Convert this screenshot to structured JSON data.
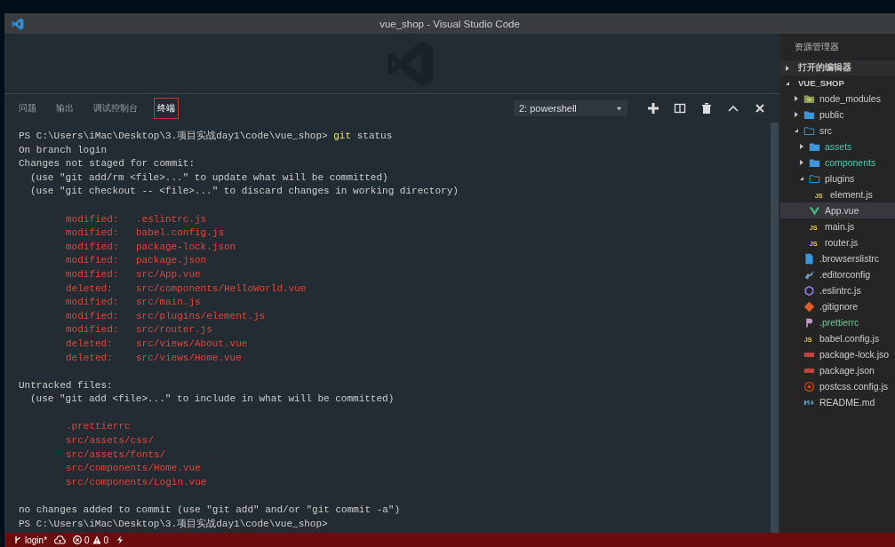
{
  "window": {
    "title": "vue_shop - Visual Studio Code"
  },
  "panel": {
    "tabs": [
      {
        "label": "问题",
        "selected": false
      },
      {
        "label": "输出",
        "selected": false
      },
      {
        "label": "调试控制台",
        "selected": false
      },
      {
        "label": "终端",
        "selected": true
      }
    ],
    "terminal_select": {
      "value": "2: powershell"
    }
  },
  "terminal": {
    "lines": [
      {
        "kind": "prompt",
        "text": "PS C:\\Users\\iMac\\Desktop\\3.项目实战day1\\code\\vue_shop>",
        "command": "git",
        "args": "status"
      },
      {
        "kind": "text",
        "text": "On branch login"
      },
      {
        "kind": "text",
        "text": "Changes not staged for commit:"
      },
      {
        "kind": "hint",
        "text": "(use \"git add/rm <file>...\" to update what will be committed)"
      },
      {
        "kind": "hint",
        "text": "(use \"git checkout -- <file>...\" to discard changes in working directory)"
      },
      {
        "kind": "blank"
      },
      {
        "kind": "change",
        "status": "modified:",
        "file": ".eslintrc.js"
      },
      {
        "kind": "change",
        "status": "modified:",
        "file": "babel.config.js"
      },
      {
        "kind": "change",
        "status": "modified:",
        "file": "package-lock.json"
      },
      {
        "kind": "change",
        "status": "modified:",
        "file": "package.json"
      },
      {
        "kind": "change",
        "status": "modified:",
        "file": "src/App.vue"
      },
      {
        "kind": "change",
        "status": "deleted:",
        "file": "src/components/HelloWorld.vue"
      },
      {
        "kind": "change",
        "status": "modified:",
        "file": "src/main.js"
      },
      {
        "kind": "change",
        "status": "modified:",
        "file": "src/plugins/element.js"
      },
      {
        "kind": "change",
        "status": "modified:",
        "file": "src/router.js"
      },
      {
        "kind": "change",
        "status": "deleted:",
        "file": "src/views/About.vue"
      },
      {
        "kind": "change",
        "status": "deleted:",
        "file": "src/views/Home.vue"
      },
      {
        "kind": "blank"
      },
      {
        "kind": "text",
        "text": "Untracked files:"
      },
      {
        "kind": "hint",
        "text": "(use \"git add <file>...\" to include in what will be committed)"
      },
      {
        "kind": "blank"
      },
      {
        "kind": "untracked",
        "text": ".prettierrc"
      },
      {
        "kind": "untracked",
        "text": "src/assets/css/"
      },
      {
        "kind": "untracked",
        "text": "src/assets/fonts/"
      },
      {
        "kind": "untracked",
        "text": "src/components/Home.vue"
      },
      {
        "kind": "untracked",
        "text": "src/components/Login.vue"
      },
      {
        "kind": "blank"
      },
      {
        "kind": "text",
        "text": "no changes added to commit (use \"git add\" and/or \"git commit -a\")"
      },
      {
        "kind": "text",
        "text": "PS C:\\Users\\iMac\\Desktop\\3.项目实战day1\\code\\vue_shop>"
      }
    ]
  },
  "sidebar": {
    "title": "资源管理器",
    "sections": [
      {
        "label": "打开的编辑器",
        "expanded": false
      },
      {
        "label": "VUE_SHOP",
        "expanded": true,
        "children": [
          {
            "name": "node_modules",
            "kind": "modules-folder",
            "expanded": false
          },
          {
            "name": "public",
            "kind": "folder",
            "expanded": false
          },
          {
            "name": "src",
            "kind": "folder",
            "expanded": true,
            "children": [
              {
                "name": "assets",
                "kind": "folder",
                "expanded": false,
                "color": "#4ec9b0"
              },
              {
                "name": "components",
                "kind": "folder",
                "expanded": false,
                "color": "#4ec9b0"
              },
              {
                "name": "plugins",
                "kind": "folder",
                "expanded": true,
                "children": [
                  {
                    "name": "element.js",
                    "kind": "js",
                    "icon_text": "JS",
                    "selected": false
                  }
                ]
              },
              {
                "name": "App.vue",
                "kind": "vue",
                "selected": true
              },
              {
                "name": "main.js",
                "kind": "js",
                "icon_text": "JS",
                "selected": false
              },
              {
                "name": "router.js",
                "kind": "js",
                "icon_text": "JS",
                "selected": false
              }
            ]
          },
          {
            "name": ".browserslistrc",
            "kind": "file",
            "selected": false
          },
          {
            "name": ".editorconfig",
            "kind": "editorconfig",
            "selected": false
          },
          {
            "name": ".eslintrc.js",
            "kind": "eslint",
            "selected": false
          },
          {
            "name": ".gitignore",
            "kind": "git",
            "selected": false
          },
          {
            "name": ".prettierrc",
            "kind": "prettier",
            "selected": false,
            "color": "#73c991"
          },
          {
            "name": "babel.config.js",
            "kind": "js",
            "icon_text": "JS",
            "selected": false
          },
          {
            "name": "package-lock.jso",
            "kind": "json",
            "selected": false
          },
          {
            "name": "package.json",
            "kind": "json",
            "selected": false
          },
          {
            "name": "postcss.config.js",
            "kind": "postcss",
            "selected": false
          },
          {
            "name": "README.md",
            "kind": "md",
            "selected": false
          }
        ]
      }
    ]
  },
  "status_bar": {
    "branch": "login*",
    "errors": "0",
    "warnings": "0"
  }
}
